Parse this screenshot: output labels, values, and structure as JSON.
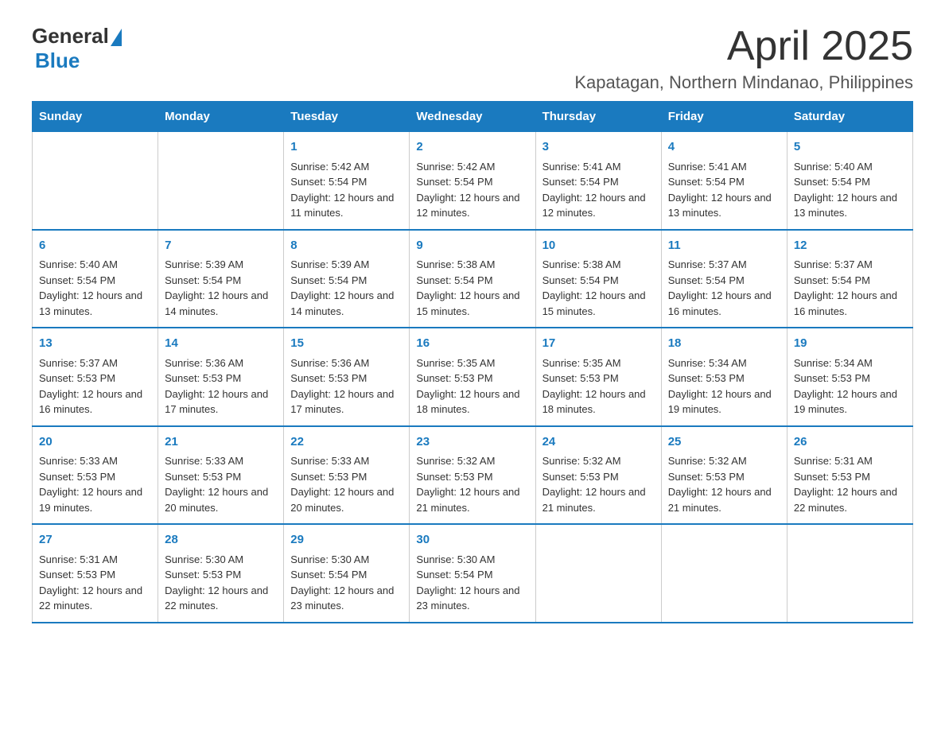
{
  "header": {
    "logo": {
      "general": "General",
      "blue": "Blue"
    },
    "title": "April 2025",
    "location": "Kapatagan, Northern Mindanao, Philippines"
  },
  "calendar": {
    "days_of_week": [
      "Sunday",
      "Monday",
      "Tuesday",
      "Wednesday",
      "Thursday",
      "Friday",
      "Saturday"
    ],
    "weeks": [
      [
        {
          "day": "",
          "sunrise": "",
          "sunset": "",
          "daylight": ""
        },
        {
          "day": "",
          "sunrise": "",
          "sunset": "",
          "daylight": ""
        },
        {
          "day": "1",
          "sunrise": "Sunrise: 5:42 AM",
          "sunset": "Sunset: 5:54 PM",
          "daylight": "Daylight: 12 hours and 11 minutes."
        },
        {
          "day": "2",
          "sunrise": "Sunrise: 5:42 AM",
          "sunset": "Sunset: 5:54 PM",
          "daylight": "Daylight: 12 hours and 12 minutes."
        },
        {
          "day": "3",
          "sunrise": "Sunrise: 5:41 AM",
          "sunset": "Sunset: 5:54 PM",
          "daylight": "Daylight: 12 hours and 12 minutes."
        },
        {
          "day": "4",
          "sunrise": "Sunrise: 5:41 AM",
          "sunset": "Sunset: 5:54 PM",
          "daylight": "Daylight: 12 hours and 13 minutes."
        },
        {
          "day": "5",
          "sunrise": "Sunrise: 5:40 AM",
          "sunset": "Sunset: 5:54 PM",
          "daylight": "Daylight: 12 hours and 13 minutes."
        }
      ],
      [
        {
          "day": "6",
          "sunrise": "Sunrise: 5:40 AM",
          "sunset": "Sunset: 5:54 PM",
          "daylight": "Daylight: 12 hours and 13 minutes."
        },
        {
          "day": "7",
          "sunrise": "Sunrise: 5:39 AM",
          "sunset": "Sunset: 5:54 PM",
          "daylight": "Daylight: 12 hours and 14 minutes."
        },
        {
          "day": "8",
          "sunrise": "Sunrise: 5:39 AM",
          "sunset": "Sunset: 5:54 PM",
          "daylight": "Daylight: 12 hours and 14 minutes."
        },
        {
          "day": "9",
          "sunrise": "Sunrise: 5:38 AM",
          "sunset": "Sunset: 5:54 PM",
          "daylight": "Daylight: 12 hours and 15 minutes."
        },
        {
          "day": "10",
          "sunrise": "Sunrise: 5:38 AM",
          "sunset": "Sunset: 5:54 PM",
          "daylight": "Daylight: 12 hours and 15 minutes."
        },
        {
          "day": "11",
          "sunrise": "Sunrise: 5:37 AM",
          "sunset": "Sunset: 5:54 PM",
          "daylight": "Daylight: 12 hours and 16 minutes."
        },
        {
          "day": "12",
          "sunrise": "Sunrise: 5:37 AM",
          "sunset": "Sunset: 5:54 PM",
          "daylight": "Daylight: 12 hours and 16 minutes."
        }
      ],
      [
        {
          "day": "13",
          "sunrise": "Sunrise: 5:37 AM",
          "sunset": "Sunset: 5:53 PM",
          "daylight": "Daylight: 12 hours and 16 minutes."
        },
        {
          "day": "14",
          "sunrise": "Sunrise: 5:36 AM",
          "sunset": "Sunset: 5:53 PM",
          "daylight": "Daylight: 12 hours and 17 minutes."
        },
        {
          "day": "15",
          "sunrise": "Sunrise: 5:36 AM",
          "sunset": "Sunset: 5:53 PM",
          "daylight": "Daylight: 12 hours and 17 minutes."
        },
        {
          "day": "16",
          "sunrise": "Sunrise: 5:35 AM",
          "sunset": "Sunset: 5:53 PM",
          "daylight": "Daylight: 12 hours and 18 minutes."
        },
        {
          "day": "17",
          "sunrise": "Sunrise: 5:35 AM",
          "sunset": "Sunset: 5:53 PM",
          "daylight": "Daylight: 12 hours and 18 minutes."
        },
        {
          "day": "18",
          "sunrise": "Sunrise: 5:34 AM",
          "sunset": "Sunset: 5:53 PM",
          "daylight": "Daylight: 12 hours and 19 minutes."
        },
        {
          "day": "19",
          "sunrise": "Sunrise: 5:34 AM",
          "sunset": "Sunset: 5:53 PM",
          "daylight": "Daylight: 12 hours and 19 minutes."
        }
      ],
      [
        {
          "day": "20",
          "sunrise": "Sunrise: 5:33 AM",
          "sunset": "Sunset: 5:53 PM",
          "daylight": "Daylight: 12 hours and 19 minutes."
        },
        {
          "day": "21",
          "sunrise": "Sunrise: 5:33 AM",
          "sunset": "Sunset: 5:53 PM",
          "daylight": "Daylight: 12 hours and 20 minutes."
        },
        {
          "day": "22",
          "sunrise": "Sunrise: 5:33 AM",
          "sunset": "Sunset: 5:53 PM",
          "daylight": "Daylight: 12 hours and 20 minutes."
        },
        {
          "day": "23",
          "sunrise": "Sunrise: 5:32 AM",
          "sunset": "Sunset: 5:53 PM",
          "daylight": "Daylight: 12 hours and 21 minutes."
        },
        {
          "day": "24",
          "sunrise": "Sunrise: 5:32 AM",
          "sunset": "Sunset: 5:53 PM",
          "daylight": "Daylight: 12 hours and 21 minutes."
        },
        {
          "day": "25",
          "sunrise": "Sunrise: 5:32 AM",
          "sunset": "Sunset: 5:53 PM",
          "daylight": "Daylight: 12 hours and 21 minutes."
        },
        {
          "day": "26",
          "sunrise": "Sunrise: 5:31 AM",
          "sunset": "Sunset: 5:53 PM",
          "daylight": "Daylight: 12 hours and 22 minutes."
        }
      ],
      [
        {
          "day": "27",
          "sunrise": "Sunrise: 5:31 AM",
          "sunset": "Sunset: 5:53 PM",
          "daylight": "Daylight: 12 hours and 22 minutes."
        },
        {
          "day": "28",
          "sunrise": "Sunrise: 5:30 AM",
          "sunset": "Sunset: 5:53 PM",
          "daylight": "Daylight: 12 hours and 22 minutes."
        },
        {
          "day": "29",
          "sunrise": "Sunrise: 5:30 AM",
          "sunset": "Sunset: 5:54 PM",
          "daylight": "Daylight: 12 hours and 23 minutes."
        },
        {
          "day": "30",
          "sunrise": "Sunrise: 5:30 AM",
          "sunset": "Sunset: 5:54 PM",
          "daylight": "Daylight: 12 hours and 23 minutes."
        },
        {
          "day": "",
          "sunrise": "",
          "sunset": "",
          "daylight": ""
        },
        {
          "day": "",
          "sunrise": "",
          "sunset": "",
          "daylight": ""
        },
        {
          "day": "",
          "sunrise": "",
          "sunset": "",
          "daylight": ""
        }
      ]
    ]
  }
}
